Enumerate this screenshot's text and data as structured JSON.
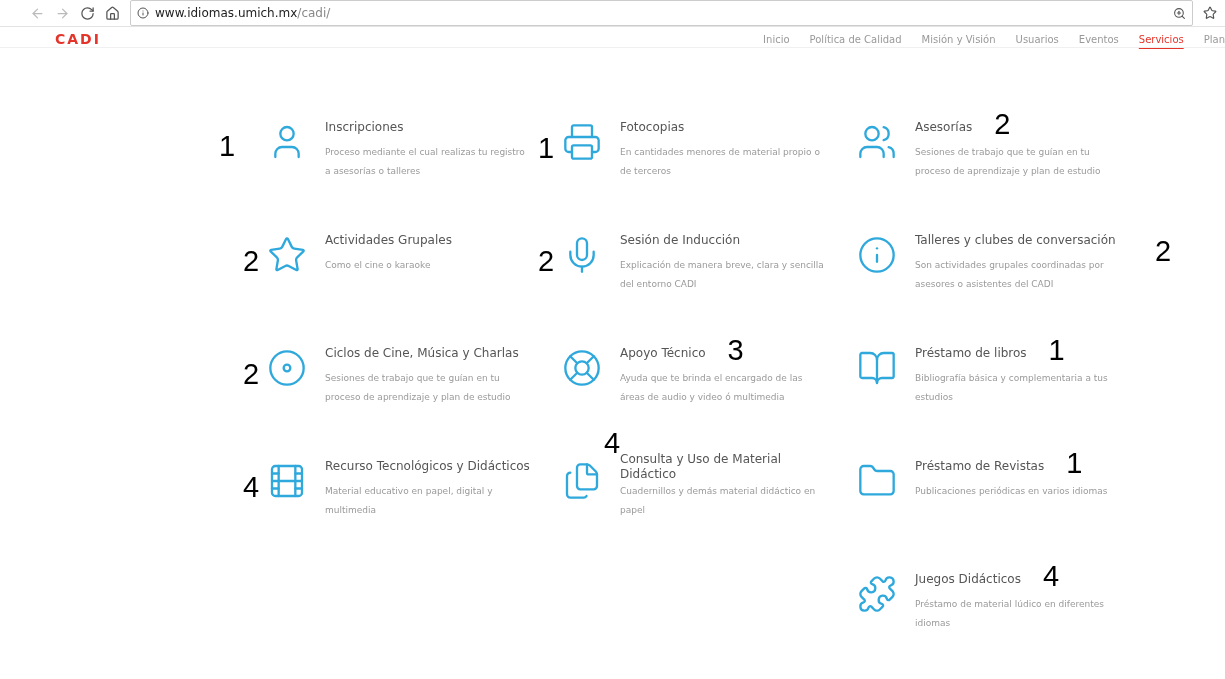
{
  "browser": {
    "url_host": "www.idiomas.umich.mx",
    "url_path": "/cadi/"
  },
  "site": {
    "logo": "CADI",
    "nav": [
      {
        "label": "Inicio",
        "selected": false
      },
      {
        "label": "Política de Calidad",
        "selected": false
      },
      {
        "label": "Misión y Visión",
        "selected": false
      },
      {
        "label": "Usuarios",
        "selected": false
      },
      {
        "label": "Eventos",
        "selected": false
      },
      {
        "label": "Servicios",
        "selected": true
      },
      {
        "label": "Plan",
        "selected": false
      }
    ]
  },
  "services": [
    {
      "title": "Inscripciones",
      "description": "Proceso mediante el cual realizas tu registro a asesorías o talleres",
      "mark": {
        "text": "1",
        "kind": "margin"
      }
    },
    {
      "title": "Fotocopias",
      "description": "En cantidades menores de material propio o de terceros",
      "mark": {
        "text": "1",
        "kind": "left"
      }
    },
    {
      "title": "Asesorías",
      "description": "Sesiones de trabajo que te guían en tu proceso de aprendizaje y plan de estudio",
      "mark": {
        "text": "2",
        "kind": "after"
      }
    },
    {
      "title": "Actividades Grupales",
      "description": "Como el cine o karaoke",
      "mark": {
        "text": "2",
        "kind": "left"
      }
    },
    {
      "title": "Sesión de Inducción",
      "description": "Explicación de manera breve, clara y sencilla del entorno CADI",
      "mark": {
        "text": "2",
        "kind": "left"
      }
    },
    {
      "title": "Talleres y clubes de conversación",
      "description": "Son actividades grupales coordinadas por asesores o asistentes del CADI",
      "mark": {
        "text": "2",
        "kind": "right"
      }
    },
    {
      "title": "Ciclos de Cine, Música y Charlas",
      "description": "Sesiones de trabajo que te guían en tu proceso de aprendizaje y plan de estudio",
      "mark": {
        "text": "2",
        "kind": "left"
      }
    },
    {
      "title": "Apoyo Técnico",
      "description": "Ayuda que te brinda el encargado de las áreas de audio y video ó multimedia",
      "mark": {
        "text": "3",
        "kind": "after"
      }
    },
    {
      "title": "Préstamo de libros",
      "description": "Bibliografía básica y complementaria a tus estudios",
      "mark": {
        "text": "1",
        "kind": "after"
      }
    },
    {
      "title": "Recurso Tecnológicos y Didácticos",
      "description": "Material educativo en papel, digital y multimedia",
      "mark": {
        "text": "4",
        "kind": "left"
      }
    },
    {
      "title": "Consulta y Uso de Material Didáctico",
      "description": "Cuadernillos y demás material didáctico en papel",
      "mark": {
        "text": "4",
        "kind": "above"
      }
    },
    {
      "title": "Préstamo de Revistas",
      "description": "Publicaciones periódicas en varios idiomas",
      "mark": {
        "text": "1",
        "kind": "after"
      }
    },
    {
      "title": "Juegos Didácticos",
      "description": "Préstamo de material lúdico en diferentes idiomas",
      "mark": {
        "text": "4",
        "kind": "after"
      }
    }
  ]
}
